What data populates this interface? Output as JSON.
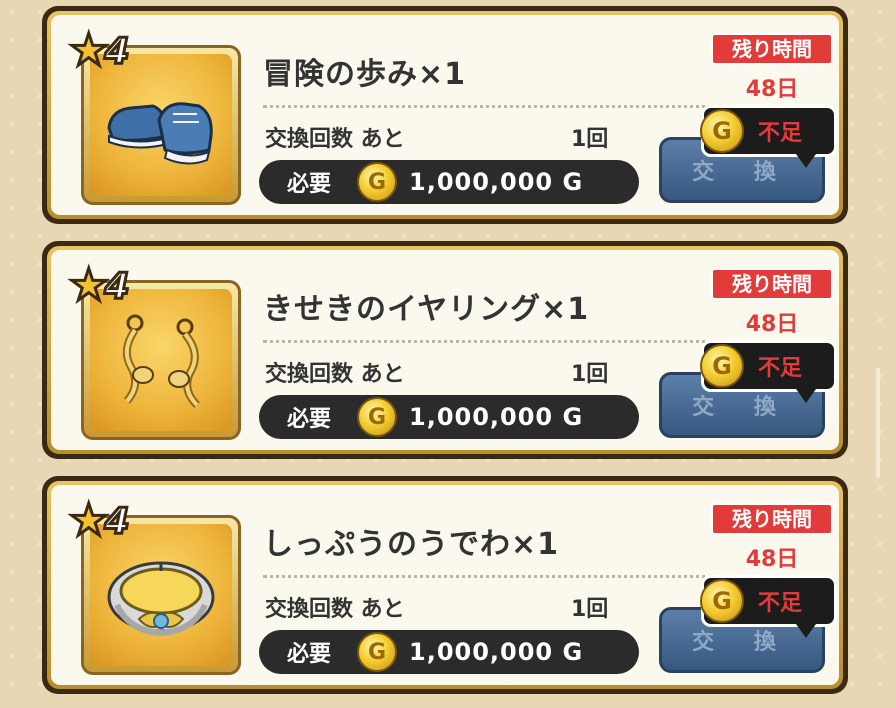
{
  "labels": {
    "time_remaining": "残り時間",
    "exchange_count_label": "交換回数 あと",
    "required_label": "必要",
    "exchange_button": "交 換",
    "insufficient": "不足",
    "coin_letter": "G"
  },
  "items": [
    {
      "rarity": "4",
      "name": "冒険の歩み×1",
      "time_value": "48日",
      "count_value": "1回",
      "cost": "1,000,000 G",
      "icon": "sneakers-icon"
    },
    {
      "rarity": "4",
      "name": "きせきのイヤリング×1",
      "time_value": "48日",
      "count_value": "1回",
      "cost": "1,000,000 G",
      "icon": "earrings-icon"
    },
    {
      "rarity": "4",
      "name": "しっぷうのうでわ×1",
      "time_value": "48日",
      "count_value": "1回",
      "cost": "1,000,000 G",
      "icon": "bracelet-icon"
    }
  ],
  "colors": {
    "accent_red": "#e23b39",
    "gold": "#e9c463",
    "button_blue": "#37587f"
  }
}
